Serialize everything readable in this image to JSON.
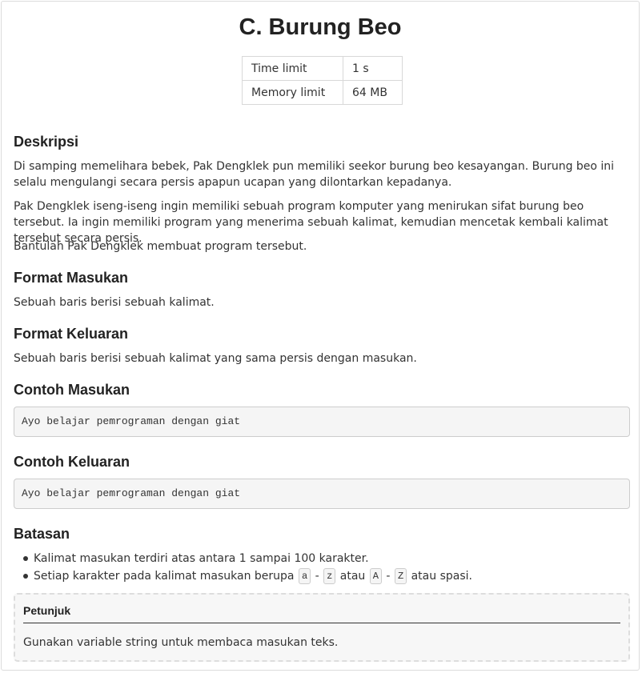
{
  "problem": {
    "title": "C. Burung Beo",
    "limits": [
      {
        "label": "Time limit",
        "value": "1 s"
      },
      {
        "label": "Memory limit",
        "value": "64 MB"
      }
    ]
  },
  "sections": {
    "description": {
      "heading": "Deskripsi",
      "paragraphs": [
        "Di samping memelihara bebek, Pak Dengklek pun memiliki seekor burung beo kesayangan. Burung beo ini selalu mengulangi secara persis apapun ucapan yang dilontarkan kepadanya.",
        "Pak Dengklek iseng-iseng ingin memiliki sebuah program komputer yang menirukan sifat burung beo tersebut. Ia ingin memiliki program yang menerima sebuah kalimat, kemudian mencetak kembali kalimat tersebut secara persis.",
        "Bantulah Pak Dengklek membuat program tersebut."
      ]
    },
    "input_format": {
      "heading": "Format Masukan",
      "text": "Sebuah baris berisi sebuah kalimat."
    },
    "output_format": {
      "heading": "Format Keluaran",
      "text": "Sebuah baris berisi sebuah kalimat yang sama persis dengan masukan."
    },
    "sample_input": {
      "heading": "Contoh Masukan",
      "text": "Ayo belajar pemrograman dengan giat"
    },
    "sample_output": {
      "heading": "Contoh Keluaran",
      "text": "Ayo belajar pemrograman dengan giat"
    },
    "constraints": {
      "heading": "Batasan",
      "item1": "Kalimat masukan terdiri atas antara 1 sampai 100 karakter.",
      "item2": {
        "prefix": "Setiap karakter pada kalimat masukan berupa",
        "code1": "a",
        "dash1": "-",
        "code2": "z",
        "mid": "atau",
        "code3": "A",
        "dash2": "-",
        "code4": "Z",
        "suffix": "atau spasi."
      }
    },
    "hint": {
      "title": "Petunjuk",
      "text": "Gunakan variable string untuk membaca masukan teks."
    }
  }
}
